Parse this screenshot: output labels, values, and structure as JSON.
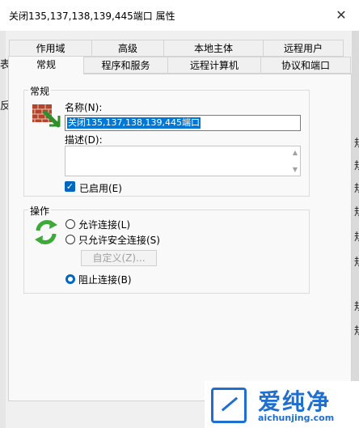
{
  "window": {
    "title": "关闭135,137,138,139,445端口 属性",
    "close_glyph": "✕"
  },
  "tabs_row1": [
    {
      "label": "作用域"
    },
    {
      "label": "高级"
    },
    {
      "label": "本地主体"
    },
    {
      "label": "远程用户"
    }
  ],
  "tabs_row2": [
    {
      "label": "常规",
      "active": true
    },
    {
      "label": "程序和服务"
    },
    {
      "label": "远程计算机"
    },
    {
      "label": "协议和端口"
    }
  ],
  "general": {
    "group_title": "常规",
    "icon": "firewall-rule-icon",
    "name_label": "名称(N):",
    "name_value": "关闭135,137,138,139,445端口",
    "description_label": "描述(D):",
    "description_value": "",
    "enabled_label": "已启用(E)",
    "enabled": true
  },
  "action": {
    "group_title": "操作",
    "icon": "refresh-arrows-icon",
    "options": [
      {
        "label": "允许连接(L)",
        "selected": false
      },
      {
        "label": "只允许安全连接(S)",
        "selected": false
      },
      {
        "label": "阻止连接(B)",
        "selected": true
      }
    ],
    "customize_label": "自定义(Z)..."
  },
  "background_chars": {
    "left": [
      "表",
      "反"
    ],
    "right": [
      "规",
      "规",
      "规",
      "规",
      "规",
      "规",
      "规",
      "规"
    ]
  },
  "watermark": {
    "text": "爱纯净",
    "url": "aichunjing.com"
  },
  "colors": {
    "accent": "#0067c0",
    "selection": "#0078d7",
    "watermark": "#1f6fd1"
  }
}
